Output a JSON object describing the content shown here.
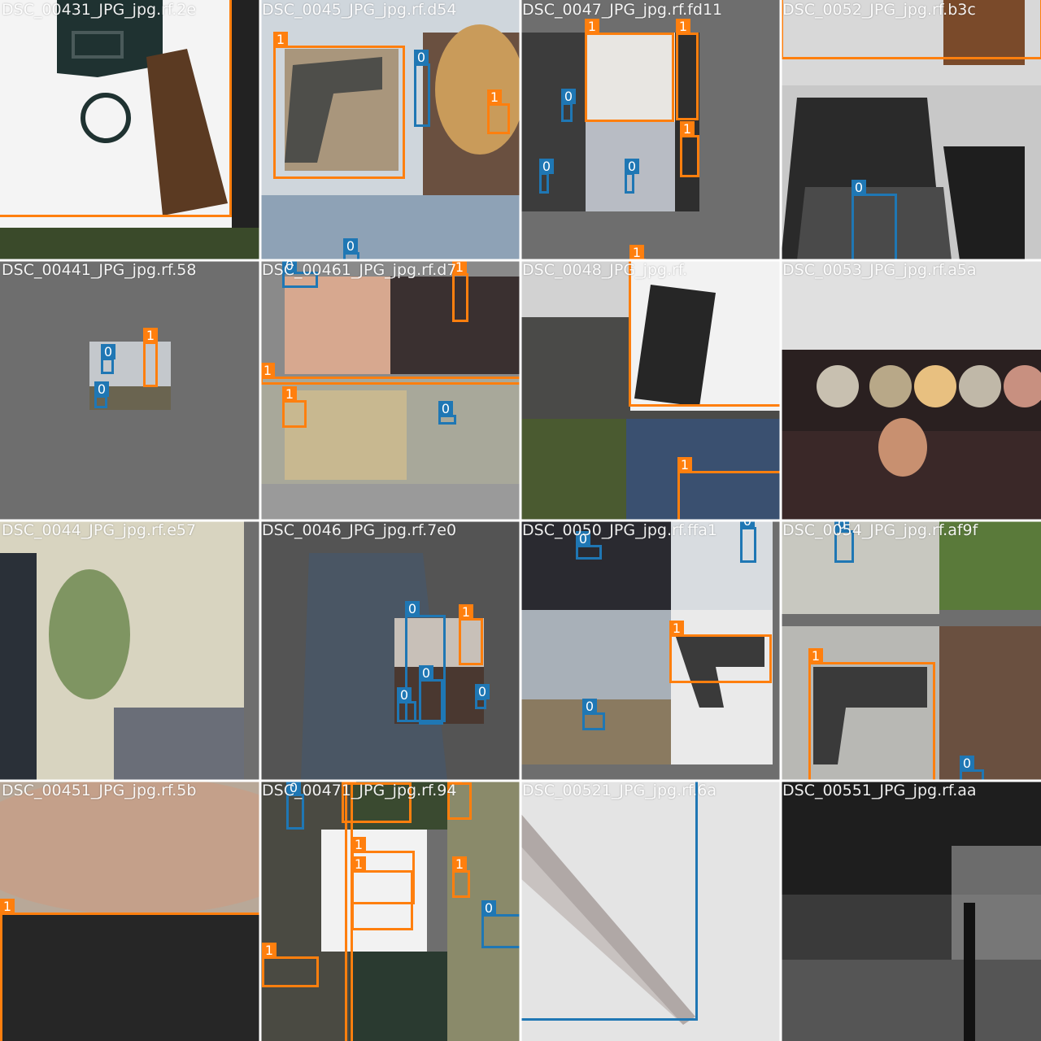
{
  "classes": {
    "0": "0",
    "1": "1"
  },
  "colors": {
    "class_0": "#1f77b4",
    "class_1": "#ff7f0e",
    "padding_gray": "#6e6e6e",
    "tile_divider": "#ffffff"
  },
  "tiles": [
    {
      "title": "DSC_00431_JPG_jpg.rf.2e"
    },
    {
      "title": "DSC_0045_JPG_jpg.rf.d54"
    },
    {
      "title": "DSC_0047_JPG_jpg.rf.fd11"
    },
    {
      "title": "DSC_0052_JPG_jpg.rf.b3c"
    },
    {
      "title": "DSC_00441_JPG_jpg.rf.58"
    },
    {
      "title": "DSC_00461_JPG_jpg.rf.d7"
    },
    {
      "title": "DSC_0048_JPG_jpg.rf."
    },
    {
      "title": "DSC_0053_JPG_jpg.rf.a5a"
    },
    {
      "title": "DSC_0044_JPG_jpg.rf.e57"
    },
    {
      "title": "DSC_0046_JPG_jpg.rf.7e0"
    },
    {
      "title": "DSC_0050_JPG_jpg.rf.ffa1"
    },
    {
      "title": "DSC_0054_JPG_jpg.rf.af9f"
    },
    {
      "title": "DSC_00451_JPG_jpg.rf.5b"
    },
    {
      "title": "DSC_00471_JPG_jpg.rf.94"
    },
    {
      "title": "DSC_00521_JPG_jpg.rf.6a"
    },
    {
      "title": "DSC_00551_JPG_jpg.rf.aa"
    }
  ]
}
